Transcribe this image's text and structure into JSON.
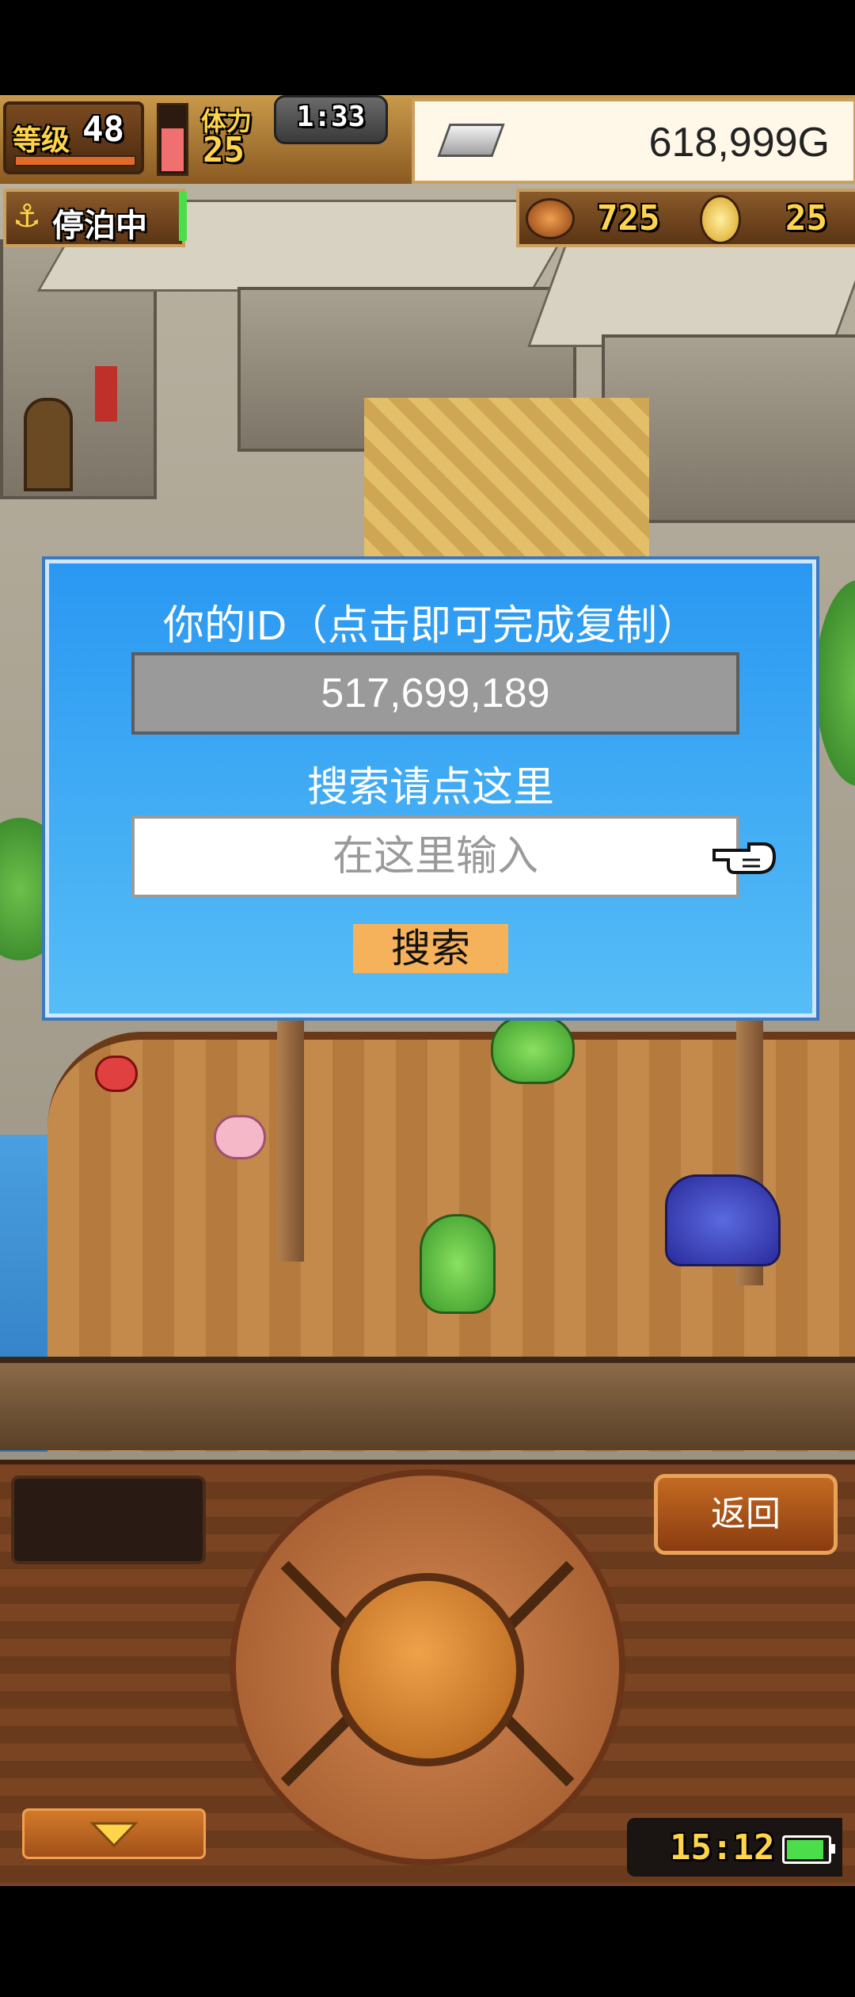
{
  "hud": {
    "level_label": "等级",
    "level_value": "48",
    "stamina_label": "体力",
    "stamina_value": "25",
    "timer": "1:33",
    "gold": "618,999G",
    "dock_status": "停泊中",
    "food_count": "725",
    "medal_count": "25"
  },
  "dialog": {
    "title": "你的ID（点击即可完成复制）",
    "player_id": "517,699,189",
    "search_label": "搜索请点这里",
    "search_placeholder": "在这里输入",
    "search_button": "搜索"
  },
  "controls": {
    "back_button": "返回",
    "clock": "15:12"
  },
  "colors": {
    "dialog_bg": "#2a98f2",
    "search_button_bg": "#f6b25a",
    "battery": "#4adf4a"
  }
}
